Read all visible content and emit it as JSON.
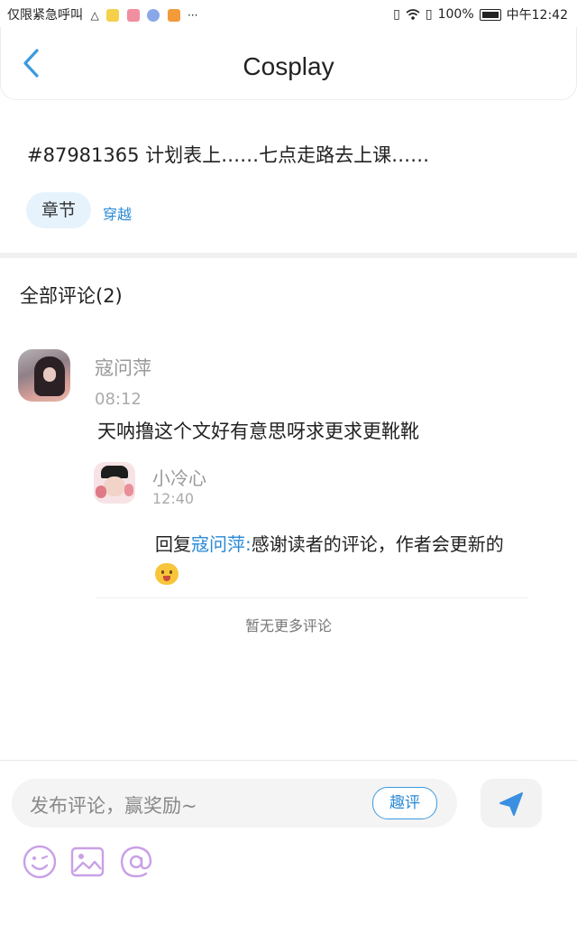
{
  "status_bar": {
    "carrier_text": "仅限紧急呼叫",
    "battery": "100%",
    "time": "中午12:42"
  },
  "header": {
    "title": "Cosplay",
    "back_icon": "chevron-left-icon"
  },
  "post": {
    "title": "#87981365 计划表上……七点走路去上课……",
    "tag_chip": "章节",
    "tag_link": "穿越"
  },
  "comments": {
    "heading": "全部评论(2)",
    "items": [
      {
        "name": "寇问萍",
        "time": "08:12",
        "text": "天呐撸这个文好有意思呀求更求更靴靴"
      }
    ],
    "reply": {
      "name": "小冷心",
      "time": "12:40",
      "prefix": "回复",
      "mention": "寇问萍:",
      "text": "感谢读者的评论，作者会更新的"
    },
    "no_more": "暂无更多评论"
  },
  "composer": {
    "placeholder": "发布评论，赢奖励~",
    "qp_label": "趣评",
    "send_icon": "send-icon",
    "tools": [
      "emoji-icon",
      "image-icon",
      "mention-icon"
    ]
  },
  "colors": {
    "accent": "#2a8ad6",
    "tool_purple": "#c9a0e6",
    "send_blue": "#3b8fe0"
  }
}
